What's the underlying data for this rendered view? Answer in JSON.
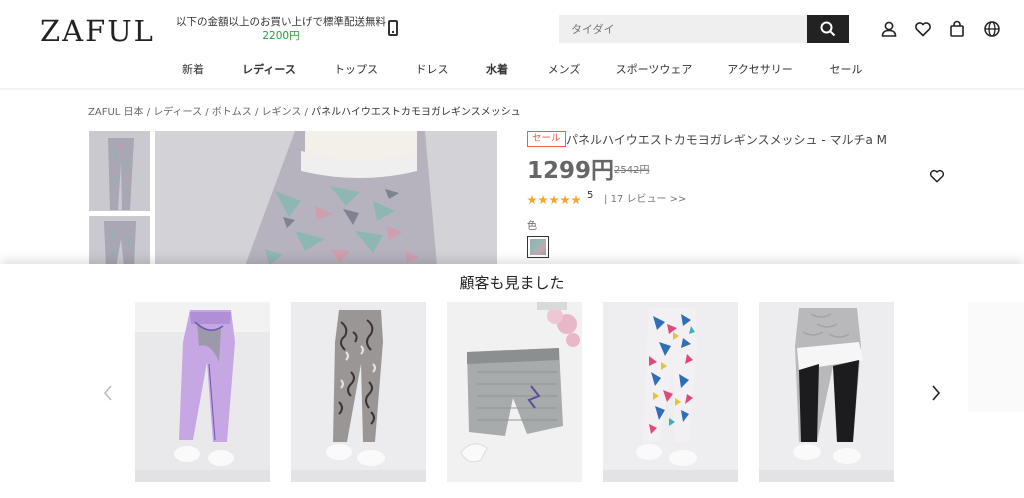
{
  "header": {
    "logo": "ZAFUL",
    "promo_line": "以下の金額以上のお買い上げで標準配送無料",
    "promo_amount": "2200円",
    "search_placeholder": "タイダイ"
  },
  "nav": [
    "新着",
    "レディース",
    "トップス",
    "ドレス",
    "水着",
    "メンズ",
    "スポーツウェア",
    "アクセサリー",
    "セール"
  ],
  "breadcrumb": {
    "items": [
      "ZAFUL 日本",
      "レディース",
      "ボトムス",
      "レギンス"
    ],
    "separator": " / ",
    "current": "パネルハイウエストカモヨガレギンスメッシュ"
  },
  "product": {
    "badge": "セール",
    "title": "パネルハイウエストカモヨガレギンスメッシュ - マルチa M",
    "price": "1299円",
    "old_price": "2542円",
    "rating": "5",
    "review_link": "17 レビュー >>",
    "color_label": "色"
  },
  "colors": {
    "sale": "#e8623b",
    "promo_amount": "#2a9d3a",
    "star": "#f5a623"
  },
  "recommend": {
    "title": "顧客も見ました"
  }
}
